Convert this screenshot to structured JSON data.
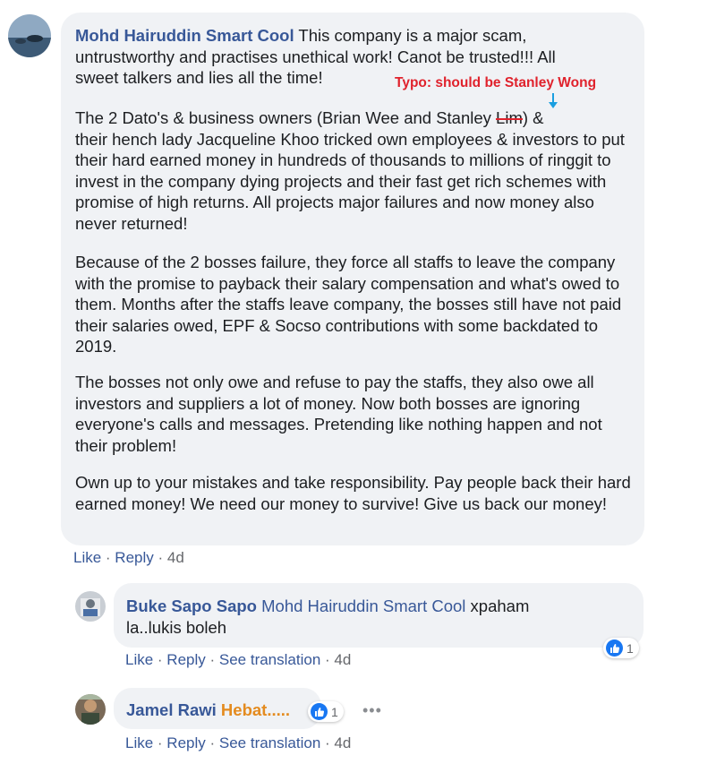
{
  "main_comment": {
    "author": "Mohd Hairuddin Smart Cool",
    "line1": " This company is a major scam,",
    "line2": "untrustworthy and practises unethical work! Canot be trusted!!! All",
    "line3": "sweet talkers and lies all the time!",
    "p2_before": "The 2 Dato's & business owners (Brian Wee and Stanley ",
    "p2_typo": "Lim",
    "p2_after": ") &",
    "p2_rest": "their hench lady Jacqueline Khoo tricked own employees & investors to put their hard earned money in hundreds of thousands to millions of ringgit to invest in the company dying projects and their fast get rich schemes with promise of high returns. All projects major failures and now money also never returned!",
    "p3": "Because of the 2 bosses failure, they force all staffs to leave the company with the promise to payback their salary compensation and what's owed to them. Months after the staffs leave company, the bosses still have not paid their salaries owed, EPF & Socso contributions with some backdated to 2019.",
    "p4": "The bosses not only owe and refuse to pay the staffs, they also owe all investors and suppliers a lot of money. Now both bosses are ignoring everyone's calls and messages. Pretending like nothing happen and not their problem!",
    "p5": "Own up to your mistakes and take responsibility. Pay people back their hard earned money! We need our money to survive! Give us back our money!",
    "annotation": "Typo: should be Stanley Wong",
    "actions": {
      "like": "Like",
      "reply": "Reply",
      "time": "4d"
    }
  },
  "reply1": {
    "author": "Buke Sapo Sapo",
    "mention": "Mohd Hairuddin Smart Cool",
    "text_a": " xpaham",
    "text_b": "la..lukis boleh",
    "reaction_count": "1",
    "actions": {
      "like": "Like",
      "reply": "Reply",
      "translate": "See translation",
      "time": "4d"
    }
  },
  "reply2": {
    "author": "Jamel Rawi",
    "text": "Hebat.....",
    "reaction_count": "1",
    "actions": {
      "like": "Like",
      "reply": "Reply",
      "translate": "See translation",
      "time": "4d"
    }
  },
  "colors": {
    "link": "#385898",
    "bubble": "#f0f2f5",
    "annotation": "#e0222c",
    "like_blue": "#1877f2",
    "orange_text": "#e48b1f"
  },
  "icons": [
    "like-thumb-icon",
    "more-options-icon",
    "down-arrow-icon"
  ]
}
